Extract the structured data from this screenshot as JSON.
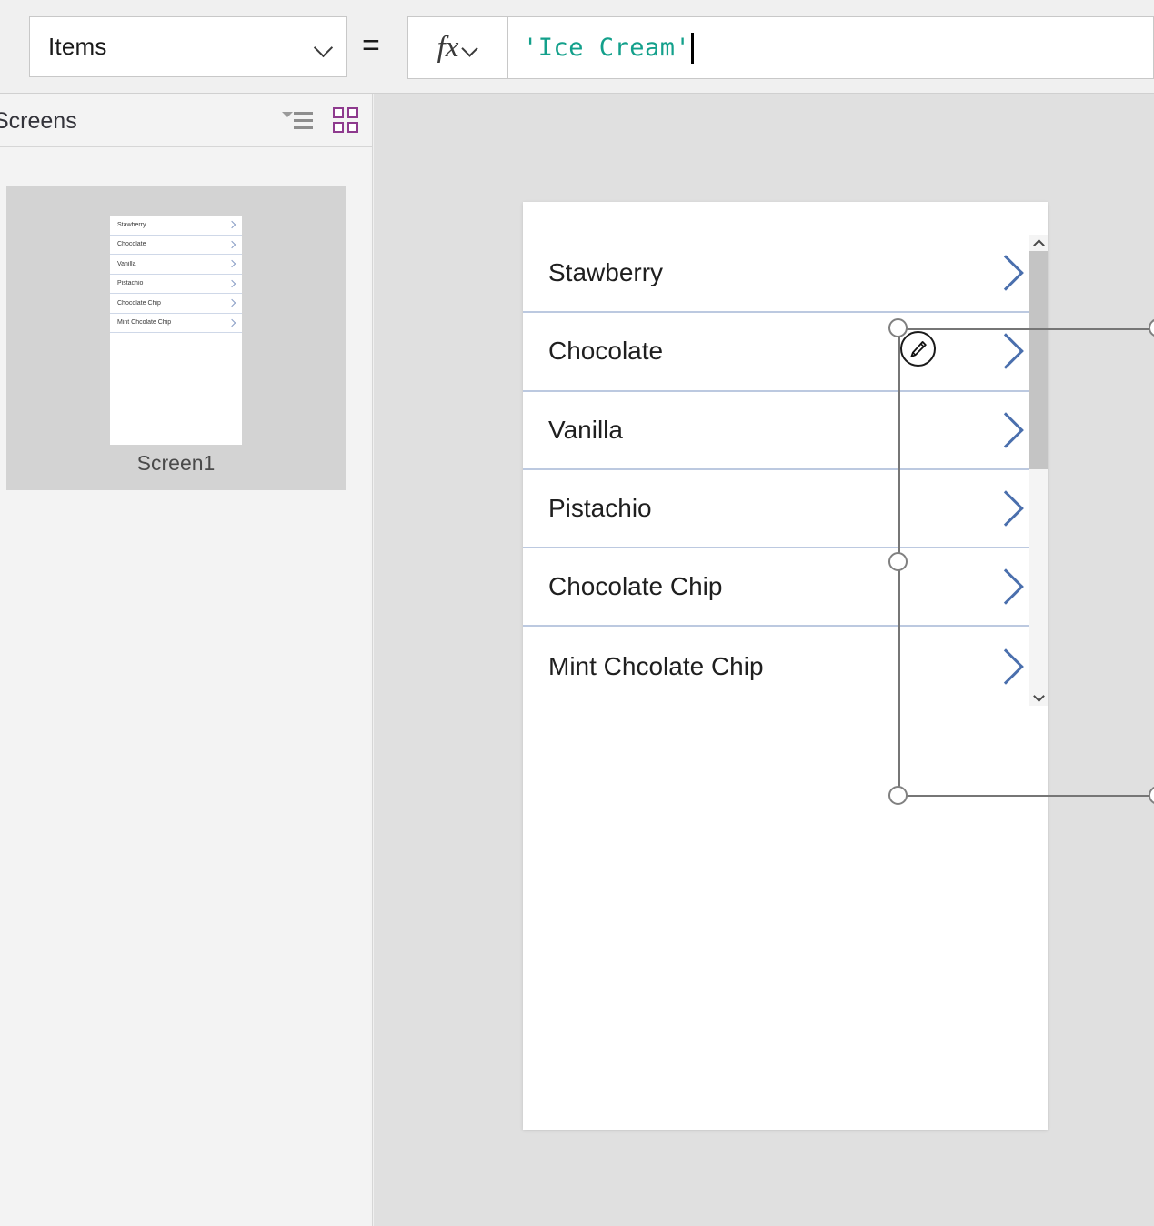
{
  "formula_bar": {
    "property_label": "Items",
    "equals_sign": "=",
    "fx_glyph": "fx",
    "formula_value": "'Ice Cream'",
    "property_dropdown_icon": "chevron-down-icon",
    "fx_dropdown_icon": "chevron-down-icon"
  },
  "left_panel": {
    "title": "Screens",
    "icons": [
      {
        "name": "tree-view-icon"
      },
      {
        "name": "grid-view-icon"
      }
    ],
    "screens": [
      {
        "name": "Screen1",
        "selected": true,
        "thumbnail_items": [
          "Stawberry",
          "Chocolate",
          "Vanilla",
          "Pistachio",
          "Chocolate Chip",
          "Mint Chcolate Chip"
        ]
      }
    ]
  },
  "canvas": {
    "gallery": {
      "selected": true,
      "edit_badge_icon": "pencil-icon",
      "scrollbar": {
        "up_arrow_icon": "chevron-up-icon",
        "down_arrow_icon": "chevron-down-icon"
      },
      "items": [
        {
          "label": "Stawberry",
          "chevron": "chevron-right-icon"
        },
        {
          "label": "Chocolate",
          "chevron": "chevron-right-icon"
        },
        {
          "label": "Vanilla",
          "chevron": "chevron-right-icon"
        },
        {
          "label": "Pistachio",
          "chevron": "chevron-right-icon"
        },
        {
          "label": "Chocolate Chip",
          "chevron": "chevron-right-icon"
        },
        {
          "label": "Mint Chcolate Chip",
          "chevron": "chevron-right-icon"
        }
      ]
    }
  },
  "colors": {
    "formula_text": "#13a08b",
    "chevron_blue": "#4a6fad",
    "row_separator": "#bcc9e0",
    "grid_icon_purple": "#8e3a8e",
    "panel_bg": "#f3f3f3",
    "canvas_bg": "#e0e0e0",
    "selection_border": "#767676"
  }
}
